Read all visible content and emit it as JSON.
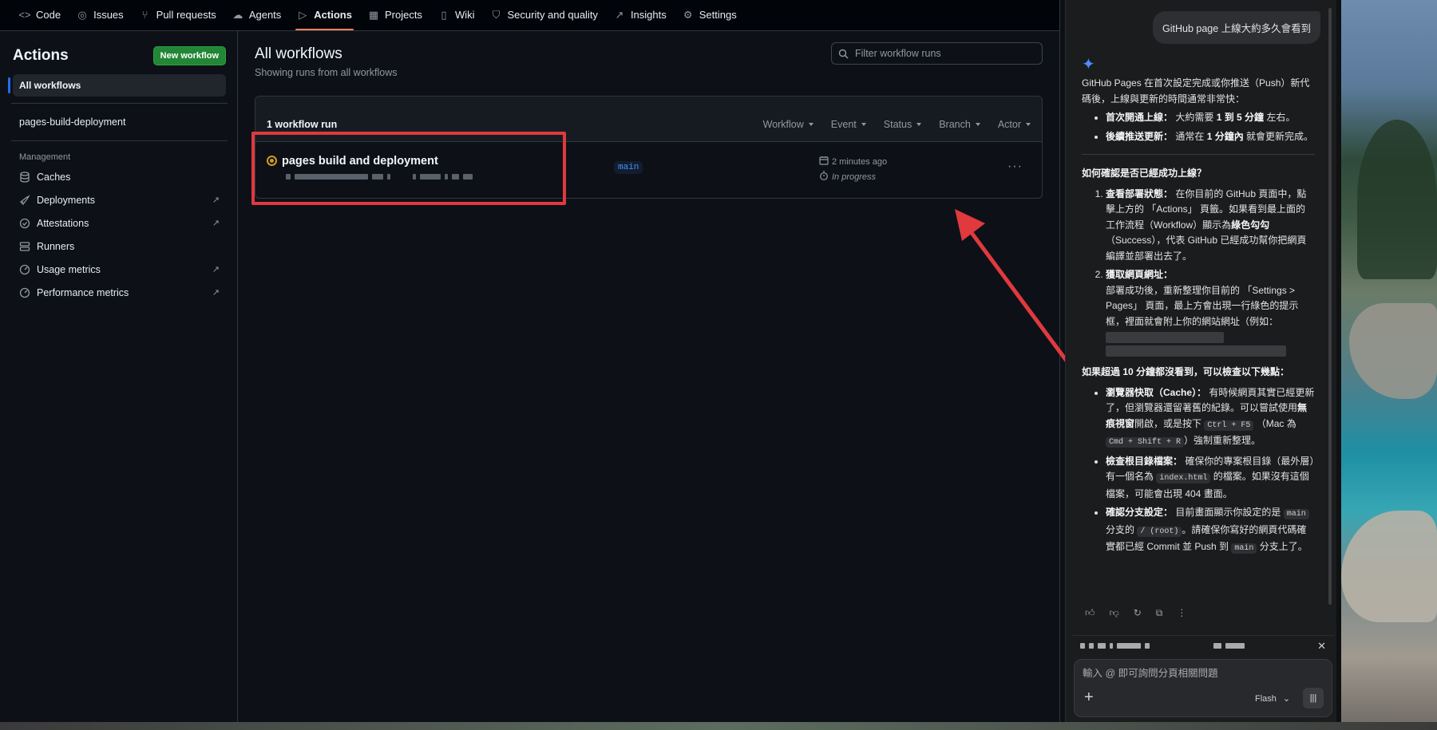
{
  "nav": {
    "tabs": [
      {
        "label": "Code",
        "icon": "code-icon"
      },
      {
        "label": "Issues",
        "icon": "issue-icon"
      },
      {
        "label": "Pull requests",
        "icon": "pull-request-icon"
      },
      {
        "label": "Agents",
        "icon": "agents-icon"
      },
      {
        "label": "Actions",
        "icon": "play-icon",
        "active": true
      },
      {
        "label": "Projects",
        "icon": "table-icon"
      },
      {
        "label": "Wiki",
        "icon": "book-icon"
      },
      {
        "label": "Security and quality",
        "icon": "shield-icon"
      },
      {
        "label": "Insights",
        "icon": "graph-icon"
      },
      {
        "label": "Settings",
        "icon": "gear-icon"
      }
    ]
  },
  "sidebar": {
    "title": "Actions",
    "new_workflow": "New workflow",
    "all_workflows": "All workflows",
    "workflow_item": "pages-build-deployment",
    "management_heading": "Management",
    "management_items": [
      {
        "label": "Caches",
        "icon": "database-icon",
        "external": false
      },
      {
        "label": "Deployments",
        "icon": "rocket-icon",
        "external": true
      },
      {
        "label": "Attestations",
        "icon": "check-circle-icon",
        "external": true
      },
      {
        "label": "Runners",
        "icon": "server-icon",
        "external": false
      },
      {
        "label": "Usage metrics",
        "icon": "meter-icon",
        "external": true
      },
      {
        "label": "Performance metrics",
        "icon": "meter-icon",
        "external": true
      }
    ]
  },
  "main": {
    "title": "All workflows",
    "subtitle": "Showing runs from all workflows",
    "filter_placeholder": "Filter workflow runs",
    "runs_count": "1 workflow run",
    "filters": [
      "Workflow",
      "Event",
      "Status",
      "Branch",
      "Actor"
    ],
    "run": {
      "title": "pages build and deployment",
      "branch": "main",
      "time": "2 minutes ago",
      "status": "In progress",
      "status_color": "#d29922"
    }
  },
  "annotation": {
    "color": "#e0393e"
  },
  "panel": {
    "user_message": "GitHub page 上線大約多久會看到",
    "answer_intro": "GitHub Pages 在首次設定完成或你推送（Push）新代碼後，上線與更新的時間通常非常快：",
    "bullets": [
      {
        "bold": "首次開通上線：",
        "text": " 大約需要 ",
        "bold2": "1 到 5 分鐘",
        "tail": " 左右。"
      },
      {
        "bold": "後續推送更新：",
        "text": " 通常在 ",
        "bold2": "1 分鐘內",
        "tail": " 就會更新完成。"
      }
    ],
    "check_heading": "如何確認是否已經成功上線？",
    "check_items": [
      {
        "bold": "查看部署狀態：",
        "text": " 在你目前的 GitHub 頁面中，點擊上方的 「Actions」 頁籤。如果看到最上面的工作流程（Workflow）顯示為",
        "bold2": "綠色勾勾",
        "tail": "（Success），代表 GitHub 已經成功幫你把網頁編譯並部署出去了。"
      },
      {
        "bold": "獲取網頁網址：",
        "text": "部署成功後，重新整理你目前的 「Settings > Pages」 頁面，最上方會出現一行綠色的提示框，裡面就會附上你的網站網址（例如："
      }
    ],
    "trouble_heading": "如果超過 10 分鐘都沒看到，可以檢查以下幾點：",
    "trouble_items": {
      "cache": {
        "bold": "瀏覽器快取（Cache）：",
        "text1": " 有時候網頁其實已經更新了，但瀏覽器還留著舊的紀錄。可以嘗試使用",
        "bold2": "無痕視窗",
        "text2": "開啟，或是按下 ",
        "code1": "Ctrl + F5",
        "text3": " （Mac 為 ",
        "code2": "Cmd + Shift + R",
        "text4": "）強制重新整理。"
      },
      "index": {
        "bold": "檢查根目錄檔案：",
        "text1": " 確保你的專案根目錄（最外層）有一個名為 ",
        "code1": "index.html",
        "text2": " 的檔案。如果沒有這個檔案，可能會出現 404 畫面。"
      },
      "branch": {
        "bold": "確認分支設定：",
        "text1": " 目前畫面顯示你設定的是 ",
        "code1": "main",
        "text2": " 分支的 ",
        "code2": "/ (root)",
        "text3": "。請確保你寫好的網頁代碼確實都已經 Commit 並 Push 到 ",
        "code3": "main",
        "text4": " 分支上了。"
      }
    },
    "composer_placeholder": "輸入 @ 即可詢問分頁相關問題",
    "model": "Flash"
  }
}
